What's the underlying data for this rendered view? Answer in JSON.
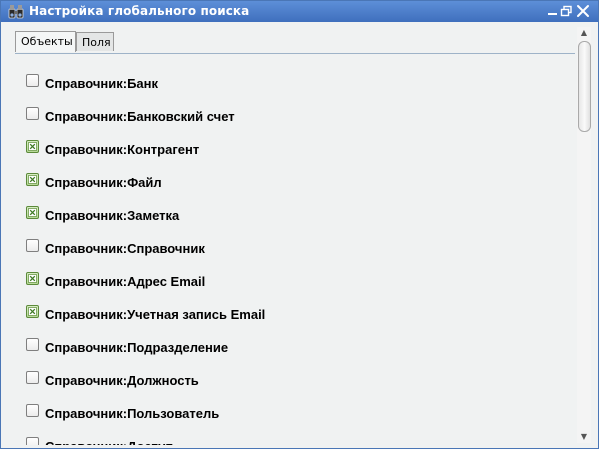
{
  "window": {
    "title": "Настройка глобального поиска"
  },
  "tabs": [
    {
      "label": "Объекты",
      "active": true
    },
    {
      "label": "Поля",
      "active": false
    }
  ],
  "items": [
    {
      "label": "Справочник:Банк",
      "checked": false
    },
    {
      "label": "Справочник:Банковский счет",
      "checked": false
    },
    {
      "label": "Справочник:Контрагент",
      "checked": true
    },
    {
      "label": "Справочник:Файл",
      "checked": true
    },
    {
      "label": "Справочник:Заметка",
      "checked": true
    },
    {
      "label": "Справочник:Справочник",
      "checked": false
    },
    {
      "label": "Справочник:Адрес Email",
      "checked": true
    },
    {
      "label": "Справочник:Учетная запись Email",
      "checked": true
    },
    {
      "label": "Справочник:Подразделение",
      "checked": false
    },
    {
      "label": "Справочник:Должность",
      "checked": false
    },
    {
      "label": "Справочник:Пользователь",
      "checked": false
    },
    {
      "label": "Справочник:Доступ",
      "checked": false
    }
  ],
  "scrollbar": {
    "position_fraction": 0.0
  }
}
